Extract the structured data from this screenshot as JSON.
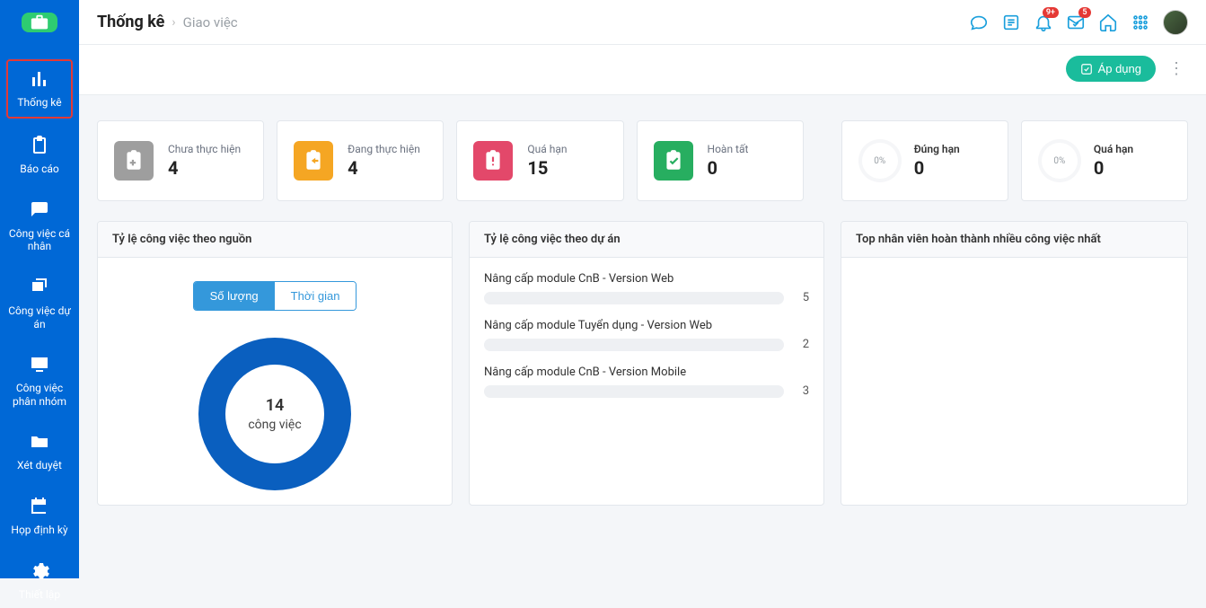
{
  "header": {
    "title": "Thống kê",
    "subtitle": "Giao việc",
    "badges": {
      "bell": "9+",
      "mail": "5"
    },
    "apply_label": "Áp dụng"
  },
  "sidebar": {
    "items": [
      {
        "label": "Thống kê",
        "active": true
      },
      {
        "label": "Báo cáo"
      },
      {
        "label": "Công việc cá nhân"
      },
      {
        "label": "Công việc dự án"
      },
      {
        "label": "Công việc phân nhóm"
      },
      {
        "label": "Xét duyệt"
      },
      {
        "label": "Họp định kỳ"
      },
      {
        "label": "Thiết lập"
      }
    ]
  },
  "stats": {
    "cards": [
      {
        "label": "Chưa thực hiện",
        "value": "4",
        "color": "#9e9e9e"
      },
      {
        "label": "Đang thực hiện",
        "value": "4",
        "color": "#f5a623"
      },
      {
        "label": "Quá hạn",
        "value": "15",
        "color": "#e3486a"
      },
      {
        "label": "Hoàn tất",
        "value": "0",
        "color": "#27ae60"
      }
    ],
    "donuts": [
      {
        "label": "Đúng hạn",
        "value": "0",
        "pct": "0%"
      },
      {
        "label": "Quá hạn",
        "value": "0",
        "pct": "0%"
      }
    ]
  },
  "panel_source": {
    "title": "Tỷ lệ công việc theo nguồn",
    "toggle": {
      "qty": "Số lượng",
      "time": "Thời gian"
    },
    "center_num": "14",
    "center_label": "công việc"
  },
  "panel_project": {
    "title": "Tỷ lệ công việc theo dự án",
    "items": [
      {
        "name": "Nâng cấp module CnB - Version Web",
        "count": "5"
      },
      {
        "name": "Nâng cấp module Tuyển dụng - Version Web",
        "count": "2"
      },
      {
        "name": "Nâng cấp module CnB - Version Mobile",
        "count": "3"
      }
    ]
  },
  "panel_top": {
    "title": "Top nhân viên hoàn thành nhiều công việc nhất"
  },
  "chart_data": {
    "type": "pie",
    "title": "Tỷ lệ công việc theo nguồn",
    "total_label": "công việc",
    "total": 14,
    "series": [
      {
        "name": "Nguồn",
        "values": [
          14
        ]
      }
    ]
  }
}
